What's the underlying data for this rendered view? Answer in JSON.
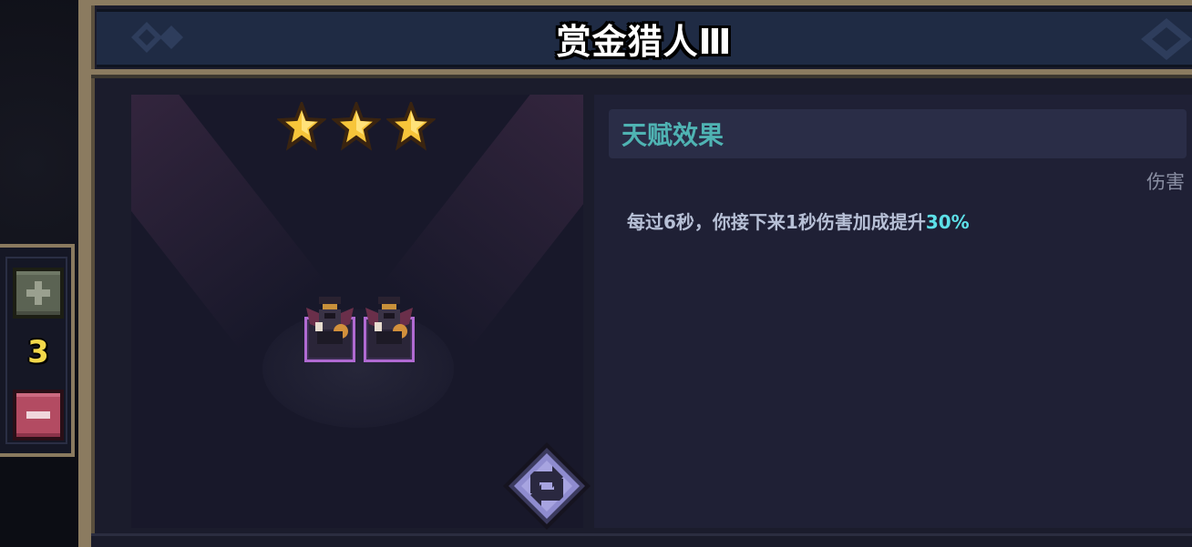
{
  "header": {
    "title": "赏金猎人Ⅲ"
  },
  "counter": {
    "plus_icon": "plus-icon",
    "value": "3",
    "minus_icon": "minus-icon"
  },
  "stage": {
    "star_rating": 3,
    "star_count": 3,
    "units": [
      {
        "name": "bounty-hunter-unit"
      },
      {
        "name": "bounty-hunter-unit"
      }
    ],
    "refresh_icon": "refresh-icon"
  },
  "talent": {
    "header": "天赋效果",
    "tag": "伤害",
    "description_prefix": "每过6秒，你接下来1秒伤害加成提升",
    "description_highlight": "30%"
  },
  "colors": {
    "highlight": "#5de0e8",
    "talent_title": "#4fb3b3",
    "star": "#f7c53a",
    "unit_border": "#b06ad2",
    "plus_button": "#5b6353",
    "minus_button": "#b34b62",
    "counter_text": "#f3d84a"
  }
}
